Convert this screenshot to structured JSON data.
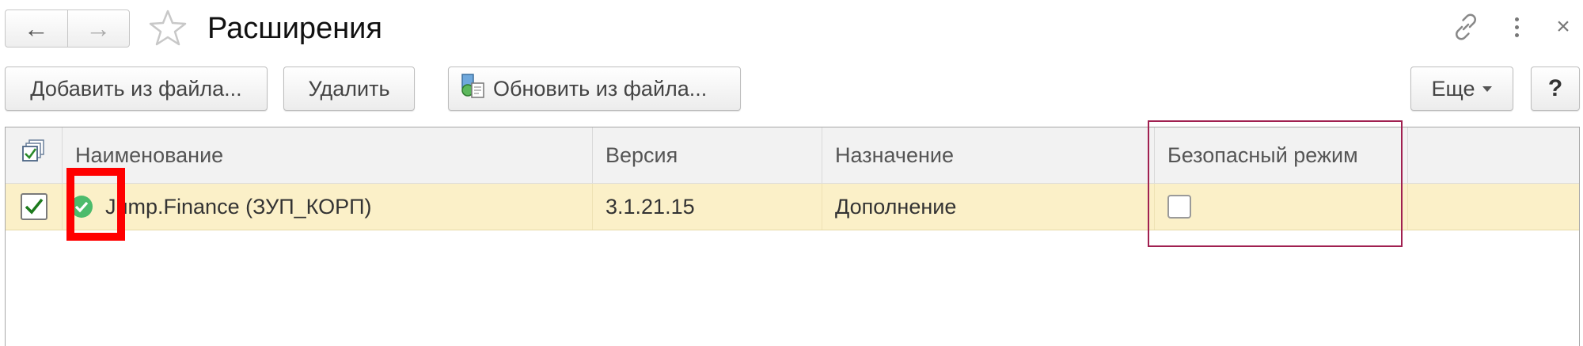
{
  "window": {
    "title": "Расширения",
    "nav_back_icon": "←",
    "nav_forward_icon": "→",
    "close_icon": "×"
  },
  "toolbar": {
    "add_from_file": "Добавить из файла...",
    "delete": "Удалить",
    "update_from_file": "Обновить из файла...",
    "more": "Еще",
    "help": "?"
  },
  "table": {
    "columns": [
      "Наименование",
      "Версия",
      "Назначение",
      "Безопасный режим"
    ],
    "rows": [
      {
        "enabled": true,
        "status": "active",
        "name": "Jump.Finance (ЗУП_КОРП)",
        "version": "3.1.21.15",
        "purpose": "Дополнение",
        "safe_mode": false
      }
    ]
  },
  "colors": {
    "selected_row": "#fbf0c8",
    "status_green": "#4cbb6c",
    "highlight_red": "#ff0000",
    "highlight_maroon": "#a02050"
  }
}
